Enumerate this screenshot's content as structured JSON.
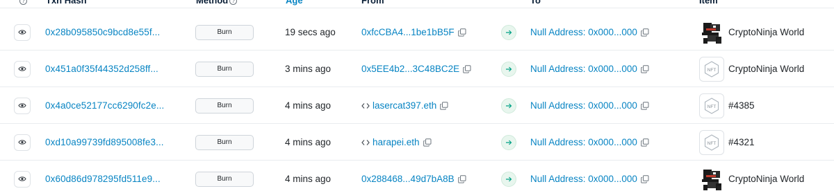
{
  "header": {
    "txn_hash": "Txn Hash",
    "method": "Method",
    "age": "Age",
    "from": "From",
    "to": "To",
    "item": "Item"
  },
  "rows": [
    {
      "txn_hash": "0x28b095850c9bcd8e55f...",
      "method": "Burn",
      "age": "19 secs ago",
      "from": "0xfcCBA4...1be1bB5F",
      "from_is_contract": false,
      "to": "Null Address: 0x000...000",
      "item_name": "CryptoNinja World",
      "item_thumb": "ninja-image"
    },
    {
      "txn_hash": "0x451a0f35f44352d258ff...",
      "method": "Burn",
      "age": "3 mins ago",
      "from": "0x5EE4b2...3C48BC2E",
      "from_is_contract": false,
      "to": "Null Address: 0x000...000",
      "item_name": "CryptoNinja World",
      "item_thumb": "nft-placeholder"
    },
    {
      "txn_hash": "0x4a0ce52177cc6290fc2e...",
      "method": "Burn",
      "age": "4 mins ago",
      "from": "lasercat397.eth",
      "from_is_contract": true,
      "to": "Null Address: 0x000...000",
      "item_name": "#4385",
      "item_thumb": "nft-placeholder"
    },
    {
      "txn_hash": "0xd10a99739fd895008fe3...",
      "method": "Burn",
      "age": "4 mins ago",
      "from": "harapei.eth",
      "from_is_contract": true,
      "to": "Null Address: 0x000...000",
      "item_name": "#4321",
      "item_thumb": "nft-placeholder"
    },
    {
      "txn_hash": "0x60d86d978295fd511e9...",
      "method": "Burn",
      "age": "4 mins ago",
      "from": "0x288468...49d7bA8B",
      "from_is_contract": false,
      "to": "Null Address: 0x000...000",
      "item_name": "CryptoNinja World",
      "item_thumb": "ninja-image"
    }
  ],
  "colors": {
    "link": "#0784c3",
    "text": "#212529",
    "transfer_arrow": "#00a186",
    "border": "#e9ecef"
  },
  "icons": {
    "view": "eye-icon",
    "copy": "copy-icon",
    "direction": "arrow-right-icon",
    "contract": "contract-code-icon",
    "info": "question-circle-icon"
  }
}
